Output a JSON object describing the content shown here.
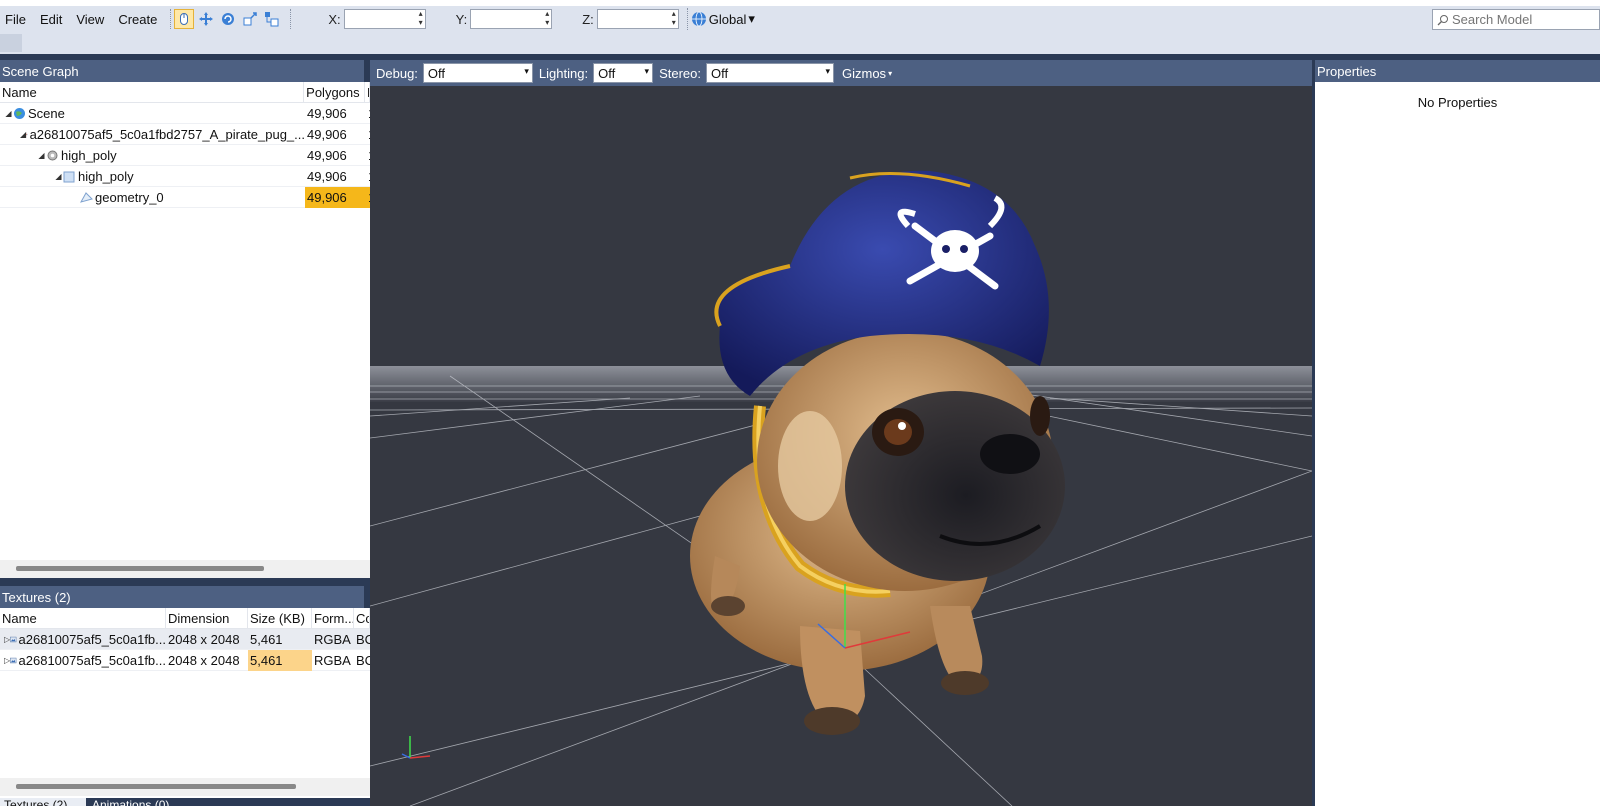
{
  "menu": {
    "file": "File",
    "edit": "Edit",
    "view": "View",
    "create": "Create"
  },
  "toolbar": {
    "x_label": "X:",
    "y_label": "Y:",
    "z_label": "Z:",
    "x_value": "",
    "y_value": "",
    "z_value": "",
    "space_label": "Global",
    "search_placeholder": "Search Model"
  },
  "scene_graph": {
    "title": "Scene Graph",
    "columns": {
      "name": "Name",
      "polygons": "Polygons",
      "extra": "P"
    },
    "rows": [
      {
        "name": "Scene",
        "polygons": "49,906",
        "extra": "1"
      },
      {
        "name": "a26810075af5_5c0a1fbd2757_A_pirate_pug_...",
        "polygons": "49,906",
        "extra": "1"
      },
      {
        "name": "high_poly",
        "polygons": "49,906",
        "extra": "1"
      },
      {
        "name": "high_poly",
        "polygons": "49,906",
        "extra": "1"
      },
      {
        "name": "geometry_0",
        "polygons": "49,906",
        "extra": "1"
      }
    ]
  },
  "textures": {
    "title": "Textures (2)",
    "columns": {
      "name": "Name",
      "dimension": "Dimension",
      "size": "Size (KB)",
      "format": "Form...",
      "extra": "Co"
    },
    "rows": [
      {
        "name": "a26810075af5_5c0a1fb...",
        "dimension": "2048 x 2048",
        "size": "5,461",
        "format": "RGBA",
        "extra": "BC"
      },
      {
        "name": "a26810075af5_5c0a1fb...",
        "dimension": "2048 x 2048",
        "size": "5,461",
        "format": "RGBA",
        "extra": "BC"
      }
    ]
  },
  "bottom_tabs": {
    "textures": "Textures (2)",
    "animations": "Animations (0)"
  },
  "viewport": {
    "debug_label": "Debug:",
    "debug_value": "Off",
    "lighting_label": "Lighting:",
    "lighting_value": "Off",
    "stereo_label": "Stereo:",
    "stereo_value": "Off",
    "gizmos_label": "Gizmos"
  },
  "properties": {
    "title": "Properties",
    "message": "No Properties"
  },
  "colors": {
    "panel_header": "#4d6082",
    "highlight": "#f5b71a",
    "viewport_bg": "#353841"
  }
}
